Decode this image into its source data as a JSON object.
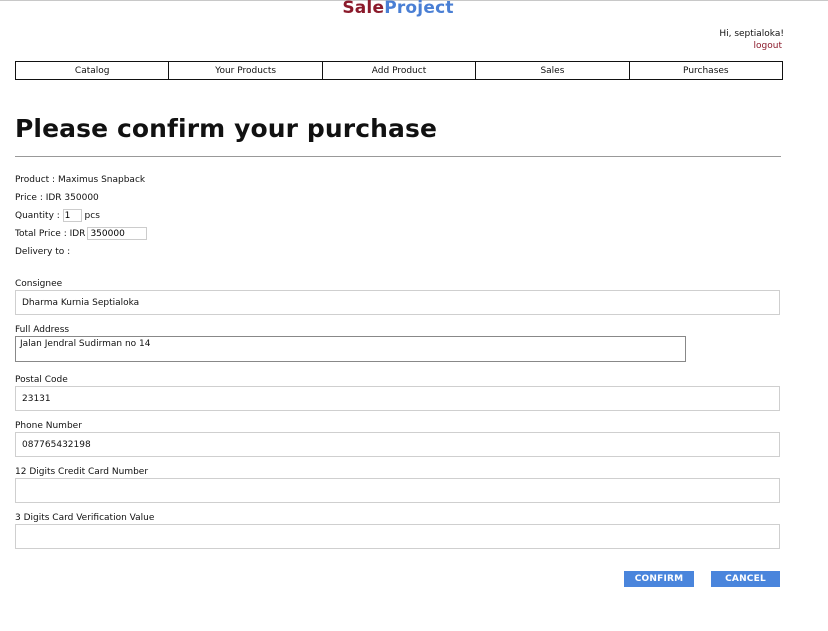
{
  "header": {
    "logo_part1": "Sale",
    "logo_part2": "Project",
    "greeting": "Hi, septialoka!",
    "logout": "logout"
  },
  "nav": {
    "items": [
      {
        "label": "Catalog"
      },
      {
        "label": "Your Products"
      },
      {
        "label": "Add Product"
      },
      {
        "label": "Sales"
      },
      {
        "label": "Purchases"
      }
    ]
  },
  "page": {
    "title": "Please confirm your purchase"
  },
  "purchase": {
    "product_label": "Product : ",
    "product_name": "Maximus Snapback",
    "price_label": "Price : ",
    "price_value": "IDR 350000",
    "quantity_label": "Quantity : ",
    "quantity_value": "1",
    "quantity_unit": "pcs",
    "total_label": "Total Price : IDR",
    "total_value": "350000",
    "delivery_label": "Delivery to :"
  },
  "form": {
    "consignee_label": "Consignee",
    "consignee_value": "Dharma Kurnia Septialoka",
    "address_label": "Full Address",
    "address_value": "Jalan Jendral Sudirman no 14",
    "postal_label": "Postal Code",
    "postal_value": "23131",
    "phone_label": "Phone Number",
    "phone_value": "087765432198",
    "cc_label": "12 Digits Credit Card Number",
    "cc_value": "",
    "cvv_label": "3 Digits Card Verification Value",
    "cvv_value": ""
  },
  "buttons": {
    "confirm": "CONFIRM",
    "cancel": "CANCEL"
  },
  "colors": {
    "brand_dark": "#8b1a2b",
    "brand_blue": "#4a7fd4",
    "button_blue": "#4a85dc"
  }
}
